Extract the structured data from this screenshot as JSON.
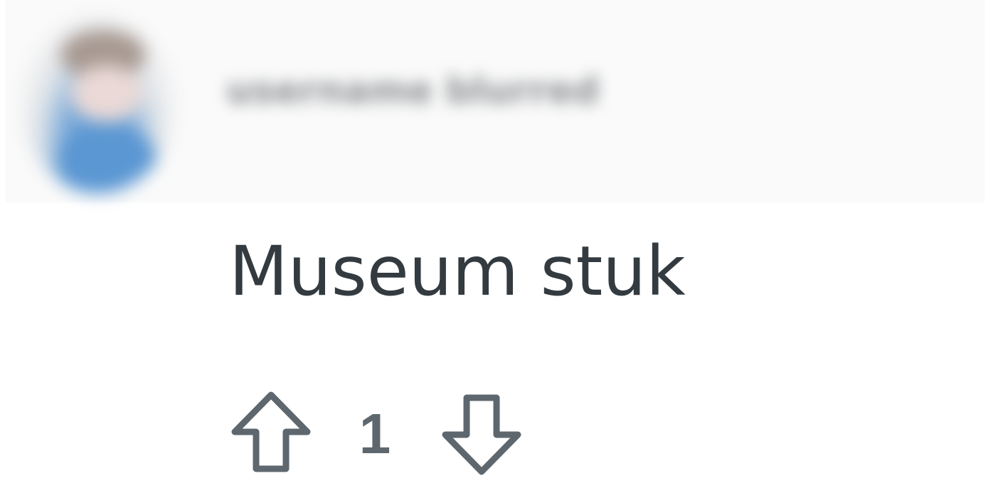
{
  "comment": {
    "author": "username blurred",
    "text": "Museum stuk",
    "score": "1"
  },
  "vote": {
    "upvote_icon": "arrow-up-outline-icon",
    "downvote_icon": "arrow-down-outline-icon"
  },
  "colors": {
    "text": "#333b40",
    "icon": "#5e676e",
    "background": "#ffffff"
  }
}
